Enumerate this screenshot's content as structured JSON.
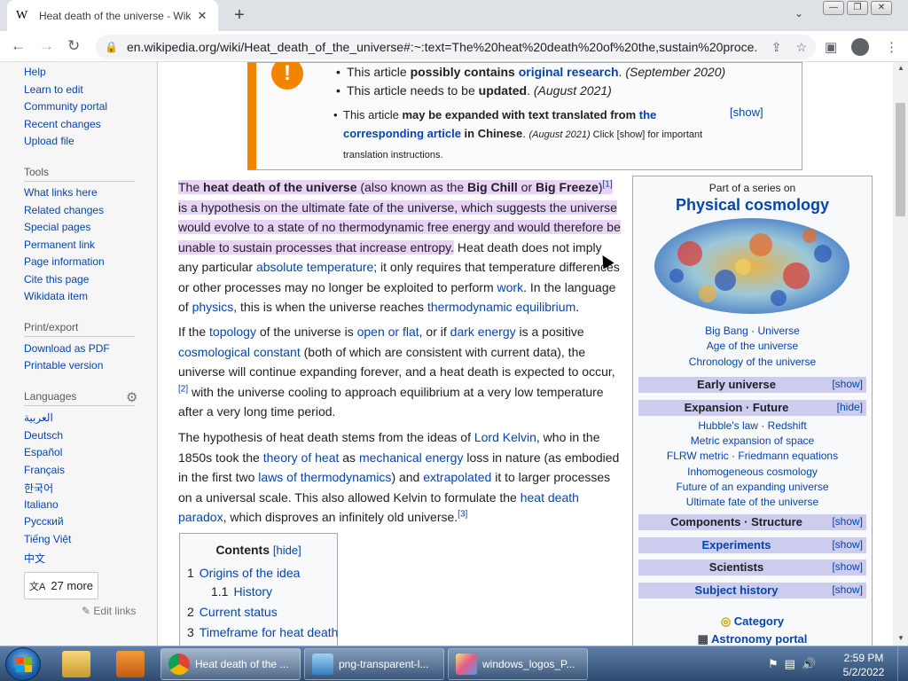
{
  "browser": {
    "tab_title": "Heat death of the universe - Wik",
    "tab_logo": "W",
    "url": "en.wikipedia.org/wiki/Heat_death_of_the_universe#:~:text=The%20heat%20death%20of%20the,sustain%20proce..."
  },
  "sidebar": {
    "top_items": [
      "Help",
      "Learn to edit",
      "Community portal",
      "Recent changes",
      "Upload file"
    ],
    "tools_heading": "Tools",
    "tools": [
      "What links here",
      "Related changes",
      "Special pages",
      "Permanent link",
      "Page information",
      "Cite this page",
      "Wikidata item"
    ],
    "print_heading": "Print/export",
    "print": [
      "Download as PDF",
      "Printable version"
    ],
    "languages_heading": "Languages",
    "languages": [
      "العربية",
      "Deutsch",
      "Español",
      "Français",
      "한국어",
      "Italiano",
      "Русский",
      "Tiếng Việt",
      "中文"
    ],
    "more_label": "27 more",
    "edit_links": "Edit links"
  },
  "ambox": {
    "icon": "!",
    "item1": {
      "pre": "This article ",
      "bold": "possibly contains ",
      "link": "original research",
      "post": ". ",
      "date": "(September 2020)"
    },
    "item2": {
      "pre": "This article needs to be ",
      "bold": "updated",
      "post": ". ",
      "date": "(August 2021)"
    },
    "item3": {
      "pre": "This article ",
      "bold": "may be expanded with text translated from ",
      "link": "the corresponding article",
      "bold2": " in Chinese",
      "post": ". ",
      "date": "(August 2021)",
      "tail": " Click [show] for important translation instructions."
    },
    "show": "[show]"
  },
  "article": {
    "p1": {
      "t1": "The ",
      "b1": "heat death of the universe",
      "t2": " (also known as the ",
      "b2": "Big Chill",
      "t3": " or ",
      "b3": "Big Freeze",
      "t4": ")",
      "ref1": "[1]",
      "t5": " is a hypothesis on the ultimate fate of the universe, which suggests the universe would evolve to a state of no thermodynamic free energy and would therefore be unable to sustain processes that increase entropy.",
      "t6": " Heat death does not imply any particular ",
      "l1": "absolute temperature",
      "t7": "; it only requires that temperature differences or other processes may no longer be exploited to perform ",
      "l2": "work",
      "t8": ". In the language of ",
      "l3": "physics",
      "t9": ", this is when the universe reaches ",
      "l4": "thermodynamic equilibrium",
      "t10": "."
    },
    "p2": {
      "t1": "If the ",
      "l1": "topology",
      "t2": " of the universe is ",
      "l2": "open or flat",
      "t3": ", or if ",
      "l3": "dark energy",
      "t4": " is a positive ",
      "l4": "cosmological constant",
      "t5": " (both of which are consistent with current data), the universe will continue expanding forever, and a heat death is expected to occur,",
      "ref": "[2]",
      "t6": " with the universe cooling to approach equilibrium at a very low temperature after a very long time period."
    },
    "p3": {
      "t1": "The hypothesis of heat death stems from the ideas of ",
      "l1": "Lord Kelvin",
      "t2": ", who in the 1850s took the ",
      "l2": "theory of heat",
      "t3": " as ",
      "l3": "mechanical energy",
      "t4": " loss in nature (as embodied in the first two ",
      "l4": "laws of thermodynamics",
      "t5": ") and ",
      "l5": "extrapolated",
      "t6": " it to larger processes on a universal scale. This also allowed Kelvin to formulate the ",
      "l6": "heat death paradox",
      "t7": ", which disproves an infinitely old universe.",
      "ref": "[3]"
    }
  },
  "toc": {
    "title": "Contents",
    "hide": "[hide]",
    "entries": [
      {
        "num": "1",
        "label": "Origins of the idea"
      },
      {
        "num": "1.1",
        "label": "History"
      },
      {
        "num": "2",
        "label": "Current status"
      },
      {
        "num": "3",
        "label": "Timeframe for heat death"
      }
    ]
  },
  "infobox": {
    "part_of": "Part of a series on",
    "series": "Physical cosmology",
    "links1": [
      "Big Bang",
      "Universe"
    ],
    "links2": "Age of the universe",
    "links3": "Chronology of the universe",
    "sections": [
      {
        "label": "Early universe",
        "toggle": "[show]",
        "link": false
      },
      {
        "label": "Expansion · Future",
        "toggle": "[hide]",
        "link": false
      },
      {
        "label": "Components · Structure",
        "toggle": "[show]",
        "link": false
      },
      {
        "label": "Experiments",
        "toggle": "[show]",
        "link": true
      },
      {
        "label": "Scientists",
        "toggle": "[show]",
        "link": false
      },
      {
        "label": "Subject history",
        "toggle": "[show]",
        "link": true
      }
    ],
    "expansion_items": [
      [
        "Hubble's law",
        "Redshift"
      ],
      [
        "Metric expansion of space"
      ],
      [
        "FLRW metric",
        "Friedmann equations"
      ],
      [
        "Inhomogeneous cosmology"
      ],
      [
        "Future of an expanding universe"
      ],
      [
        "Ultimate fate of the universe"
      ]
    ],
    "category": "Category",
    "portal": "Astronomy portal"
  },
  "taskbar": {
    "buttons": [
      "Heat death of the ...",
      "png-transparent-l...",
      "windows_logos_P..."
    ],
    "time": "2:59 PM",
    "date": "5/2/2022"
  },
  "colors": {
    "link": "#0645ad",
    "highlight": "#e9d4f7",
    "ambox_orange": "#f28500",
    "infobox_bar": "#ccccee"
  }
}
